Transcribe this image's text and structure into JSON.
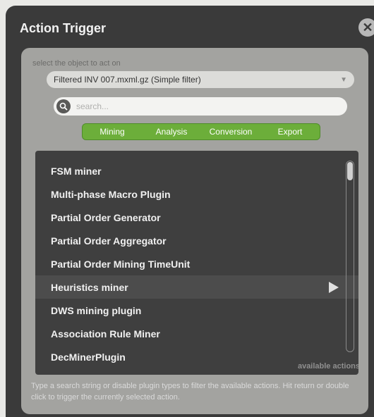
{
  "dialog": {
    "title": "Action Trigger",
    "close_label": "✕"
  },
  "object_select": {
    "label": "select the object to act on",
    "value": "Filtered INV 007.mxml.gz (Simple filter)",
    "arrow": "▼"
  },
  "search": {
    "placeholder": "search..."
  },
  "tabs": [
    "Mining",
    "Analysis",
    "Conversion",
    "Export"
  ],
  "actions": [
    "FSM miner",
    "Multi-phase Macro Plugin",
    "Partial Order Generator",
    "Partial Order Aggregator",
    "Partial Order Mining TimeUnit",
    "Heuristics miner",
    "DWS mining plugin",
    "Association Rule Miner",
    "DecMinerPlugin"
  ],
  "selected_action_index": 5,
  "available_label": "available actions",
  "hint": "Type a search string or disable plugin types to filter the available actions. Hit return or double click to trigger the currently selected action.",
  "colors": {
    "accent_green": "#6cae3a",
    "dialog_bg": "#3a3a3a"
  }
}
